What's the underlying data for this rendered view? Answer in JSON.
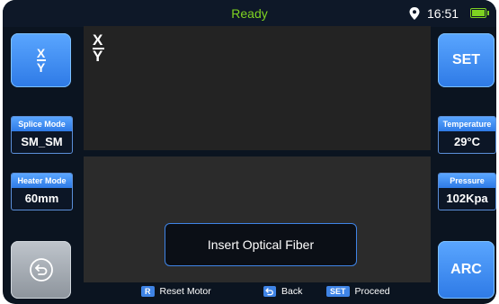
{
  "status": {
    "text": "Ready",
    "time": "16:51",
    "location_icon": "location-pin-icon",
    "battery_icon": "battery-full-icon",
    "status_color": "#7ed321"
  },
  "left_panel": {
    "xy_button": {
      "numerator": "X",
      "denominator": "Y"
    },
    "splice_mode": {
      "label": "Splice Mode",
      "value": "SM_SM"
    },
    "heater_mode": {
      "label": "Heater Mode",
      "value": "60mm"
    },
    "back_button": {
      "icon": "back-arrow-icon"
    }
  },
  "right_panel": {
    "set_button": "SET",
    "temperature": {
      "label": "Temperature",
      "value": "29°C"
    },
    "pressure": {
      "label": "Pressure",
      "value": "102Kpa"
    },
    "arc_button": "ARC"
  },
  "view": {
    "label_top": "X",
    "label_bottom": "Y"
  },
  "message": "Insert Optical Fiber",
  "hints": [
    {
      "key": "R",
      "label": "Reset Motor"
    },
    {
      "key_icon": "back-arrow-icon",
      "label": "Back"
    },
    {
      "key": "SET",
      "label": "Proceed"
    }
  ],
  "colors": {
    "accent": "#3f84e6",
    "button_blue": "#4a90f0",
    "background": "#0b1420"
  }
}
